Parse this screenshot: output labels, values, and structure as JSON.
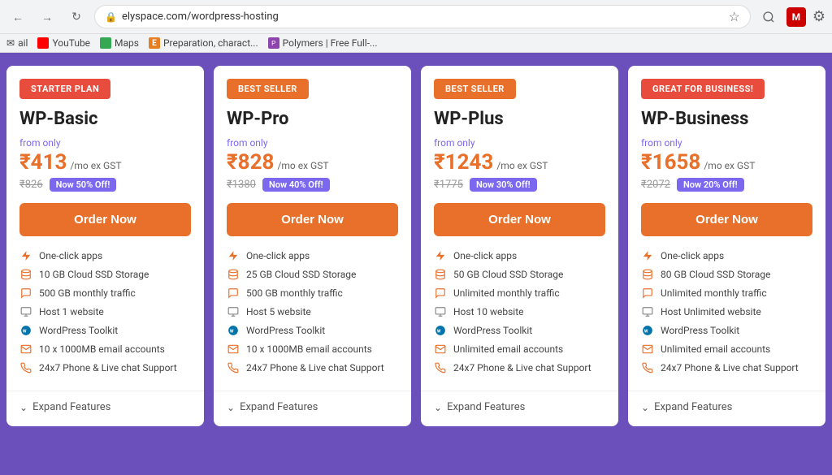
{
  "browser": {
    "url": "elyspace.com/wordpress-hosting",
    "bookmarks": [
      {
        "name": "ail",
        "type": "text"
      },
      {
        "name": "YouTube",
        "type": "youtube"
      },
      {
        "name": "Maps",
        "type": "maps"
      },
      {
        "name": "Preparation, charact...",
        "type": "e"
      },
      {
        "name": "Polymers | Free Full-...",
        "type": "polymers"
      }
    ]
  },
  "plans": [
    {
      "badge": "STARTER PLAN",
      "badge_class": "badge-starter",
      "name": "WP-Basic",
      "from_only": "from only",
      "price": "₹413",
      "price_suffix": "/mo ex GST",
      "original_price": "₹826",
      "discount": "Now 50% Off!",
      "order_btn": "Order Now",
      "features": [
        {
          "icon": "lightning",
          "text": "One-click apps"
        },
        {
          "icon": "storage",
          "text": "10 GB Cloud SSD Storage"
        },
        {
          "icon": "traffic",
          "text": "500 GB monthly traffic"
        },
        {
          "icon": "host",
          "text": "Host 1 website"
        },
        {
          "icon": "wp",
          "text": "WordPress Toolkit"
        },
        {
          "icon": "email",
          "text": "10 x 1000MB email accounts"
        },
        {
          "icon": "support",
          "text": "24x7 Phone & Live chat Support"
        }
      ],
      "expand": "Expand Features"
    },
    {
      "badge": "BEST SELLER",
      "badge_class": "badge-bestseller",
      "name": "WP-Pro",
      "from_only": "from only",
      "price": "₹828",
      "price_suffix": "/mo ex GST",
      "original_price": "₹1380",
      "discount": "Now 40% Off!",
      "order_btn": "Order Now",
      "features": [
        {
          "icon": "lightning",
          "text": "One-click apps"
        },
        {
          "icon": "storage",
          "text": "25 GB Cloud SSD Storage"
        },
        {
          "icon": "traffic",
          "text": "500 GB monthly traffic"
        },
        {
          "icon": "host",
          "text": "Host 5 website"
        },
        {
          "icon": "wp",
          "text": "WordPress Toolkit"
        },
        {
          "icon": "email",
          "text": "10 x 1000MB email accounts"
        },
        {
          "icon": "support",
          "text": "24x7 Phone & Live chat Support"
        }
      ],
      "expand": "Expand Features"
    },
    {
      "badge": "BEST SELLER",
      "badge_class": "badge-bestseller",
      "name": "WP-Plus",
      "from_only": "from only",
      "price": "₹1243",
      "price_suffix": "/mo ex GST",
      "original_price": "₹1775",
      "discount": "Now 30% Off!",
      "order_btn": "Order Now",
      "features": [
        {
          "icon": "lightning",
          "text": "One-click apps"
        },
        {
          "icon": "storage",
          "text": "50 GB Cloud SSD Storage"
        },
        {
          "icon": "traffic",
          "text": "Unlimited monthly traffic"
        },
        {
          "icon": "host",
          "text": "Host 10 website"
        },
        {
          "icon": "wp",
          "text": "WordPress Toolkit"
        },
        {
          "icon": "email",
          "text": "Unlimited email accounts"
        },
        {
          "icon": "support",
          "text": "24x7 Phone & Live chat Support"
        }
      ],
      "expand": "Expand Features"
    },
    {
      "badge": "GREAT FOR BUSINESS!",
      "badge_class": "badge-business",
      "name": "WP-Business",
      "from_only": "from only",
      "price": "₹1658",
      "price_suffix": "/mo ex GST",
      "original_price": "₹2072",
      "discount": "Now 20% Off!",
      "order_btn": "Order Now",
      "features": [
        {
          "icon": "lightning",
          "text": "One-click apps"
        },
        {
          "icon": "storage",
          "text": "80 GB Cloud SSD Storage"
        },
        {
          "icon": "traffic",
          "text": "Unlimited monthly traffic"
        },
        {
          "icon": "host",
          "text": "Host Unlimited website"
        },
        {
          "icon": "wp",
          "text": "WordPress Toolkit"
        },
        {
          "icon": "email",
          "text": "Unlimited email accounts"
        },
        {
          "icon": "support",
          "text": "24x7 Phone & Live chat Support"
        }
      ],
      "expand": "Expand Features"
    }
  ]
}
